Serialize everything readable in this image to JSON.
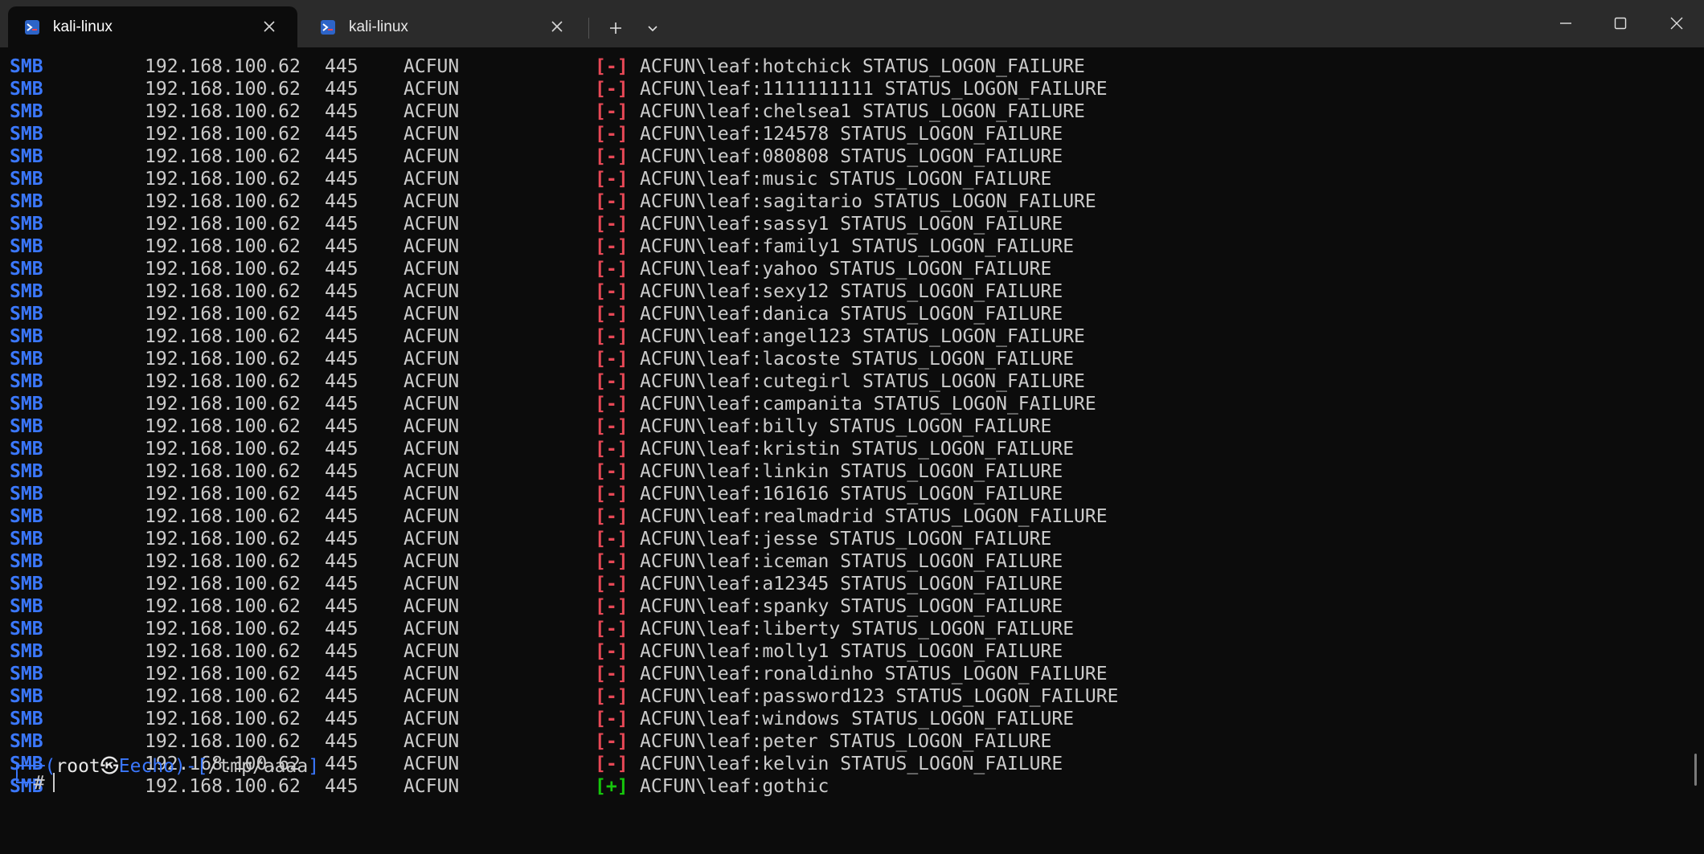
{
  "tabs": [
    {
      "title": "kali-linux",
      "active": true
    },
    {
      "title": "kali-linux",
      "active": false
    }
  ],
  "colors": {
    "background": "#0c0c0c",
    "titlebar": "#2b2b2b",
    "protocol_blue": "#3b78ff",
    "fail_red": "#e74856",
    "success_green": "#16c60c",
    "text": "#cccccc"
  },
  "icons": {
    "tab_icon": "kali-tab-icon",
    "tab_close": "close-icon",
    "new_tab": "plus-icon",
    "dropdown": "chevron-down-icon",
    "minimize": "minimize-icon",
    "maximize": "maximize-icon",
    "close_window": "close-window-icon"
  },
  "terminal": {
    "lines": [
      {
        "proto": "SMB",
        "host": "192.168.100.62",
        "port": "445",
        "domain": "ACFUN",
        "status": "[-]",
        "ok": false,
        "msg": "ACFUN\\leaf:hotchick STATUS_LOGON_FAILURE"
      },
      {
        "proto": "SMB",
        "host": "192.168.100.62",
        "port": "445",
        "domain": "ACFUN",
        "status": "[-]",
        "ok": false,
        "msg": "ACFUN\\leaf:1111111111 STATUS_LOGON_FAILURE"
      },
      {
        "proto": "SMB",
        "host": "192.168.100.62",
        "port": "445",
        "domain": "ACFUN",
        "status": "[-]",
        "ok": false,
        "msg": "ACFUN\\leaf:chelsea1 STATUS_LOGON_FAILURE"
      },
      {
        "proto": "SMB",
        "host": "192.168.100.62",
        "port": "445",
        "domain": "ACFUN",
        "status": "[-]",
        "ok": false,
        "msg": "ACFUN\\leaf:124578 STATUS_LOGON_FAILURE"
      },
      {
        "proto": "SMB",
        "host": "192.168.100.62",
        "port": "445",
        "domain": "ACFUN",
        "status": "[-]",
        "ok": false,
        "msg": "ACFUN\\leaf:080808 STATUS_LOGON_FAILURE"
      },
      {
        "proto": "SMB",
        "host": "192.168.100.62",
        "port": "445",
        "domain": "ACFUN",
        "status": "[-]",
        "ok": false,
        "msg": "ACFUN\\leaf:music STATUS_LOGON_FAILURE"
      },
      {
        "proto": "SMB",
        "host": "192.168.100.62",
        "port": "445",
        "domain": "ACFUN",
        "status": "[-]",
        "ok": false,
        "msg": "ACFUN\\leaf:sagitario STATUS_LOGON_FAILURE"
      },
      {
        "proto": "SMB",
        "host": "192.168.100.62",
        "port": "445",
        "domain": "ACFUN",
        "status": "[-]",
        "ok": false,
        "msg": "ACFUN\\leaf:sassy1 STATUS_LOGON_FAILURE"
      },
      {
        "proto": "SMB",
        "host": "192.168.100.62",
        "port": "445",
        "domain": "ACFUN",
        "status": "[-]",
        "ok": false,
        "msg": "ACFUN\\leaf:family1 STATUS_LOGON_FAILURE"
      },
      {
        "proto": "SMB",
        "host": "192.168.100.62",
        "port": "445",
        "domain": "ACFUN",
        "status": "[-]",
        "ok": false,
        "msg": "ACFUN\\leaf:yahoo STATUS_LOGON_FAILURE"
      },
      {
        "proto": "SMB",
        "host": "192.168.100.62",
        "port": "445",
        "domain": "ACFUN",
        "status": "[-]",
        "ok": false,
        "msg": "ACFUN\\leaf:sexy12 STATUS_LOGON_FAILURE"
      },
      {
        "proto": "SMB",
        "host": "192.168.100.62",
        "port": "445",
        "domain": "ACFUN",
        "status": "[-]",
        "ok": false,
        "msg": "ACFUN\\leaf:danica STATUS_LOGON_FAILURE"
      },
      {
        "proto": "SMB",
        "host": "192.168.100.62",
        "port": "445",
        "domain": "ACFUN",
        "status": "[-]",
        "ok": false,
        "msg": "ACFUN\\leaf:angel123 STATUS_LOGON_FAILURE"
      },
      {
        "proto": "SMB",
        "host": "192.168.100.62",
        "port": "445",
        "domain": "ACFUN",
        "status": "[-]",
        "ok": false,
        "msg": "ACFUN\\leaf:lacoste STATUS_LOGON_FAILURE"
      },
      {
        "proto": "SMB",
        "host": "192.168.100.62",
        "port": "445",
        "domain": "ACFUN",
        "status": "[-]",
        "ok": false,
        "msg": "ACFUN\\leaf:cutegirl STATUS_LOGON_FAILURE"
      },
      {
        "proto": "SMB",
        "host": "192.168.100.62",
        "port": "445",
        "domain": "ACFUN",
        "status": "[-]",
        "ok": false,
        "msg": "ACFUN\\leaf:campanita STATUS_LOGON_FAILURE"
      },
      {
        "proto": "SMB",
        "host": "192.168.100.62",
        "port": "445",
        "domain": "ACFUN",
        "status": "[-]",
        "ok": false,
        "msg": "ACFUN\\leaf:billy STATUS_LOGON_FAILURE"
      },
      {
        "proto": "SMB",
        "host": "192.168.100.62",
        "port": "445",
        "domain": "ACFUN",
        "status": "[-]",
        "ok": false,
        "msg": "ACFUN\\leaf:kristin STATUS_LOGON_FAILURE"
      },
      {
        "proto": "SMB",
        "host": "192.168.100.62",
        "port": "445",
        "domain": "ACFUN",
        "status": "[-]",
        "ok": false,
        "msg": "ACFUN\\leaf:linkin STATUS_LOGON_FAILURE"
      },
      {
        "proto": "SMB",
        "host": "192.168.100.62",
        "port": "445",
        "domain": "ACFUN",
        "status": "[-]",
        "ok": false,
        "msg": "ACFUN\\leaf:161616 STATUS_LOGON_FAILURE"
      },
      {
        "proto": "SMB",
        "host": "192.168.100.62",
        "port": "445",
        "domain": "ACFUN",
        "status": "[-]",
        "ok": false,
        "msg": "ACFUN\\leaf:realmadrid STATUS_LOGON_FAILURE"
      },
      {
        "proto": "SMB",
        "host": "192.168.100.62",
        "port": "445",
        "domain": "ACFUN",
        "status": "[-]",
        "ok": false,
        "msg": "ACFUN\\leaf:jesse STATUS_LOGON_FAILURE"
      },
      {
        "proto": "SMB",
        "host": "192.168.100.62",
        "port": "445",
        "domain": "ACFUN",
        "status": "[-]",
        "ok": false,
        "msg": "ACFUN\\leaf:iceman STATUS_LOGON_FAILURE"
      },
      {
        "proto": "SMB",
        "host": "192.168.100.62",
        "port": "445",
        "domain": "ACFUN",
        "status": "[-]",
        "ok": false,
        "msg": "ACFUN\\leaf:a12345 STATUS_LOGON_FAILURE"
      },
      {
        "proto": "SMB",
        "host": "192.168.100.62",
        "port": "445",
        "domain": "ACFUN",
        "status": "[-]",
        "ok": false,
        "msg": "ACFUN\\leaf:spanky STATUS_LOGON_FAILURE"
      },
      {
        "proto": "SMB",
        "host": "192.168.100.62",
        "port": "445",
        "domain": "ACFUN",
        "status": "[-]",
        "ok": false,
        "msg": "ACFUN\\leaf:liberty STATUS_LOGON_FAILURE"
      },
      {
        "proto": "SMB",
        "host": "192.168.100.62",
        "port": "445",
        "domain": "ACFUN",
        "status": "[-]",
        "ok": false,
        "msg": "ACFUN\\leaf:molly1 STATUS_LOGON_FAILURE"
      },
      {
        "proto": "SMB",
        "host": "192.168.100.62",
        "port": "445",
        "domain": "ACFUN",
        "status": "[-]",
        "ok": false,
        "msg": "ACFUN\\leaf:ronaldinho STATUS_LOGON_FAILURE"
      },
      {
        "proto": "SMB",
        "host": "192.168.100.62",
        "port": "445",
        "domain": "ACFUN",
        "status": "[-]",
        "ok": false,
        "msg": "ACFUN\\leaf:password123 STATUS_LOGON_FAILURE"
      },
      {
        "proto": "SMB",
        "host": "192.168.100.62",
        "port": "445",
        "domain": "ACFUN",
        "status": "[-]",
        "ok": false,
        "msg": "ACFUN\\leaf:windows STATUS_LOGON_FAILURE"
      },
      {
        "proto": "SMB",
        "host": "192.168.100.62",
        "port": "445",
        "domain": "ACFUN",
        "status": "[-]",
        "ok": false,
        "msg": "ACFUN\\leaf:peter STATUS_LOGON_FAILURE"
      },
      {
        "proto": "SMB",
        "host": "192.168.100.62",
        "port": "445",
        "domain": "ACFUN",
        "status": "[-]",
        "ok": false,
        "msg": "ACFUN\\leaf:kelvin STATUS_LOGON_FAILURE"
      },
      {
        "proto": "SMB",
        "host": "192.168.100.62",
        "port": "445",
        "domain": "ACFUN",
        "status": "[+]",
        "ok": true,
        "msg": "ACFUN\\leaf:gothic"
      }
    ],
    "prompt": {
      "frame_top": "┌──(",
      "user": "root㉿",
      "host": "Eecho",
      "sep": ")-[",
      "path": "/tmp/aaaa",
      "close": "]",
      "frame_bottom": "└─",
      "symbol": "#"
    }
  }
}
